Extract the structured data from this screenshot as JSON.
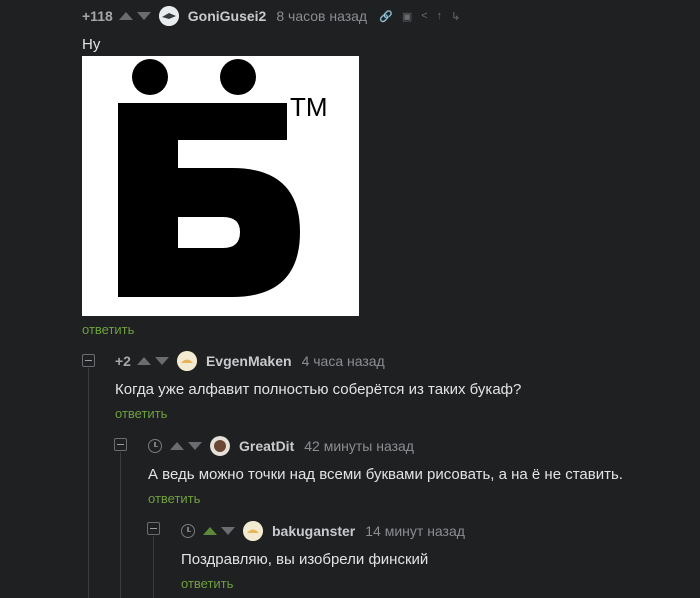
{
  "comments": [
    {
      "rating": "+118",
      "nick": "GoniGusei2",
      "time": "8 часов назад",
      "text": "Ну",
      "reply": "ответить",
      "image": {
        "letter": "Б",
        "mark": "TM"
      }
    },
    {
      "rating": "+2",
      "nick": "EvgenMaken",
      "time": "4 часа назад",
      "text": "Когда уже алфавит полностью соберётся из таких букаф?",
      "reply": "ответить"
    },
    {
      "nick": "GreatDit",
      "time": "42 минуты назад",
      "text": "А ведь можно точки над всеми буквами рисовать, а на ё не ставить.",
      "reply": "ответить"
    },
    {
      "nick": "bakuganster",
      "time": "14 минут назад",
      "text": "Поздравляю, вы изобрели финский",
      "reply": "ответить"
    }
  ],
  "colors": {
    "background": "#1f2022",
    "reply": "#6f9f3f",
    "upvoted": "#5d8a3a"
  }
}
